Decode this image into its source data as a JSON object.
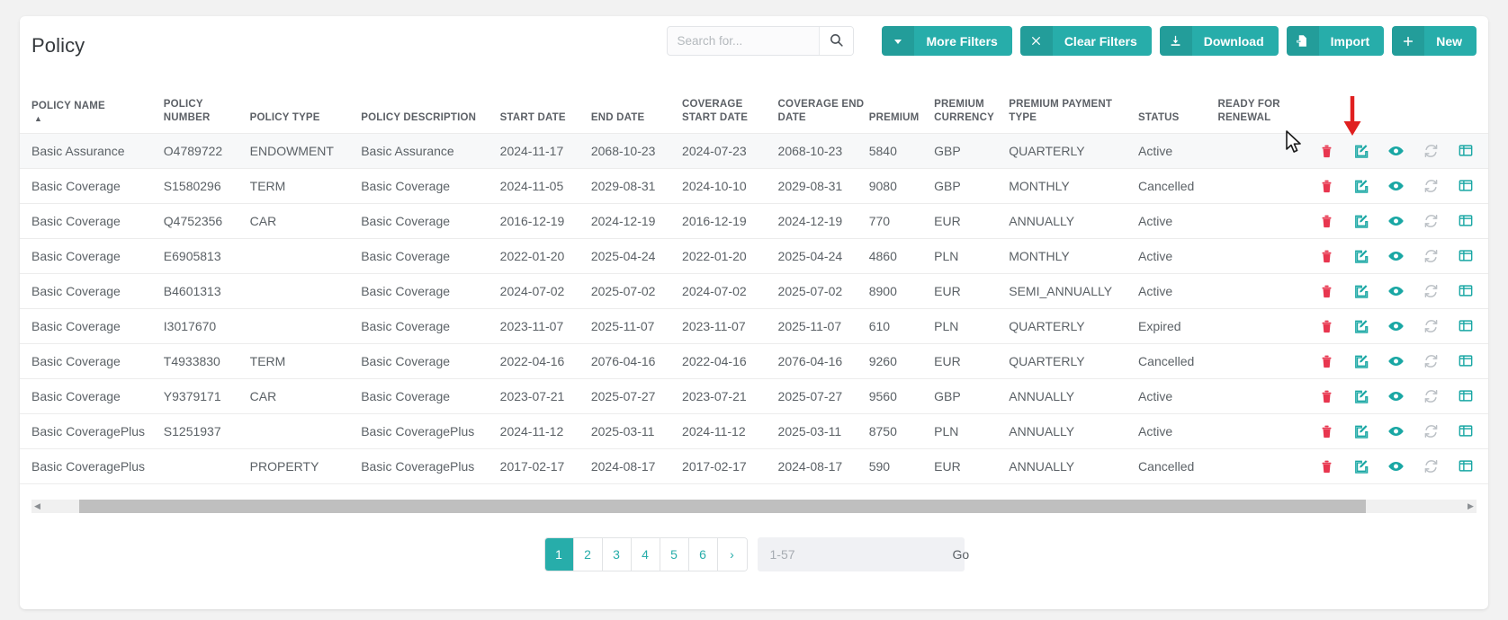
{
  "page": {
    "title": "Policy"
  },
  "search": {
    "placeholder": "Search for...",
    "value": "",
    "icon": "search-icon"
  },
  "toolbar": {
    "more_filters": {
      "label": "More Filters",
      "icon": "chevron-down-icon"
    },
    "clear_filters": {
      "label": "Clear Filters",
      "icon": "close-x-icon"
    },
    "download": {
      "label": "Download",
      "icon": "download-icon"
    },
    "import": {
      "label": "Import",
      "icon": "file-import-icon"
    },
    "new": {
      "label": "New",
      "icon": "plus-icon"
    }
  },
  "colors": {
    "accent": "#27adaa",
    "danger": "#e8364f",
    "arrow": "#e02020",
    "text": "#5b6166",
    "header_text": "#5c6066",
    "page_bg": "#f2f2f2"
  },
  "table": {
    "sort": {
      "column": "POLICY NAME",
      "direction": "asc",
      "caret": "▲"
    },
    "columns": [
      "POLICY NAME",
      "POLICY NUMBER",
      "POLICY TYPE",
      "POLICY DESCRIPTION",
      "START DATE",
      "END DATE",
      "COVERAGE START DATE",
      "COVERAGE END DATE",
      "PREMIUM",
      "PREMIUM CURRENCY",
      "PREMIUM PAYMENT TYPE",
      "STATUS",
      "READY FOR RENEWAL"
    ],
    "row_actions": [
      {
        "name": "delete-icon",
        "title": "Delete"
      },
      {
        "name": "edit-icon",
        "title": "Edit"
      },
      {
        "name": "eye-view-icon",
        "title": "View"
      },
      {
        "name": "refresh-icon",
        "title": "Refresh"
      },
      {
        "name": "columns-icon",
        "title": "Columns"
      },
      {
        "name": "save-icon",
        "title": "Save"
      }
    ],
    "rows": [
      {
        "policy_name": "Basic Assurance",
        "policy_number": "O4789722",
        "policy_type": "ENDOWMENT",
        "policy_description": "Basic Assurance",
        "start_date": "2024-11-17",
        "end_date": "2068-10-23",
        "coverage_start_date": "2024-07-23",
        "coverage_end_date": "2068-10-23",
        "premium": "5840",
        "premium_currency": "GBP",
        "premium_payment_type": "QUARTERLY",
        "status": "Active",
        "ready_for_renewal": ""
      },
      {
        "policy_name": "Basic Coverage",
        "policy_number": "S1580296",
        "policy_type": "TERM",
        "policy_description": "Basic Coverage",
        "start_date": "2024-11-05",
        "end_date": "2029-08-31",
        "coverage_start_date": "2024-10-10",
        "coverage_end_date": "2029-08-31",
        "premium": "9080",
        "premium_currency": "GBP",
        "premium_payment_type": "MONTHLY",
        "status": "Cancelled",
        "ready_for_renewal": ""
      },
      {
        "policy_name": "Basic Coverage",
        "policy_number": "Q4752356",
        "policy_type": "CAR",
        "policy_description": "Basic Coverage",
        "start_date": "2016-12-19",
        "end_date": "2024-12-19",
        "coverage_start_date": "2016-12-19",
        "coverage_end_date": "2024-12-19",
        "premium": "770",
        "premium_currency": "EUR",
        "premium_payment_type": "ANNUALLY",
        "status": "Active",
        "ready_for_renewal": ""
      },
      {
        "policy_name": "Basic Coverage",
        "policy_number": "E6905813",
        "policy_type": "",
        "policy_description": "Basic Coverage",
        "start_date": "2022-01-20",
        "end_date": "2025-04-24",
        "coverage_start_date": "2022-01-20",
        "coverage_end_date": "2025-04-24",
        "premium": "4860",
        "premium_currency": "PLN",
        "premium_payment_type": "MONTHLY",
        "status": "Active",
        "ready_for_renewal": ""
      },
      {
        "policy_name": "Basic Coverage",
        "policy_number": "B4601313",
        "policy_type": "",
        "policy_description": "Basic Coverage",
        "start_date": "2024-07-02",
        "end_date": "2025-07-02",
        "coverage_start_date": "2024-07-02",
        "coverage_end_date": "2025-07-02",
        "premium": "8900",
        "premium_currency": "EUR",
        "premium_payment_type": "SEMI_ANNUALLY",
        "status": "Active",
        "ready_for_renewal": ""
      },
      {
        "policy_name": "Basic Coverage",
        "policy_number": "I3017670",
        "policy_type": "",
        "policy_description": "Basic Coverage",
        "start_date": "2023-11-07",
        "end_date": "2025-11-07",
        "coverage_start_date": "2023-11-07",
        "coverage_end_date": "2025-11-07",
        "premium": "610",
        "premium_currency": "PLN",
        "premium_payment_type": "QUARTERLY",
        "status": "Expired",
        "ready_for_renewal": ""
      },
      {
        "policy_name": "Basic Coverage",
        "policy_number": "T4933830",
        "policy_type": "TERM",
        "policy_description": "Basic Coverage",
        "start_date": "2022-04-16",
        "end_date": "2076-04-16",
        "coverage_start_date": "2022-04-16",
        "coverage_end_date": "2076-04-16",
        "premium": "9260",
        "premium_currency": "EUR",
        "premium_payment_type": "QUARTERLY",
        "status": "Cancelled",
        "ready_for_renewal": ""
      },
      {
        "policy_name": "Basic Coverage",
        "policy_number": "Y9379171",
        "policy_type": "CAR",
        "policy_description": "Basic Coverage",
        "start_date": "2023-07-21",
        "end_date": "2025-07-27",
        "coverage_start_date": "2023-07-21",
        "coverage_end_date": "2025-07-27",
        "premium": "9560",
        "premium_currency": "GBP",
        "premium_payment_type": "ANNUALLY",
        "status": "Active",
        "ready_for_renewal": ""
      },
      {
        "policy_name": "Basic CoveragePlus",
        "policy_number": "S1251937",
        "policy_type": "",
        "policy_description": "Basic CoveragePlus",
        "start_date": "2024-11-12",
        "end_date": "2025-03-11",
        "coverage_start_date": "2024-11-12",
        "coverage_end_date": "2025-03-11",
        "premium": "8750",
        "premium_currency": "PLN",
        "premium_payment_type": "ANNUALLY",
        "status": "Active",
        "ready_for_renewal": ""
      },
      {
        "policy_name": "Basic CoveragePlus",
        "policy_number": "",
        "policy_type": "PROPERTY",
        "policy_description": "Basic CoveragePlus",
        "start_date": "2017-02-17",
        "end_date": "2024-08-17",
        "coverage_start_date": "2017-02-17",
        "coverage_end_date": "2024-08-17",
        "premium": "590",
        "premium_currency": "EUR",
        "premium_payment_type": "ANNUALLY",
        "status": "Cancelled",
        "ready_for_renewal": ""
      }
    ]
  },
  "pagination": {
    "pages": [
      "1",
      "2",
      "3",
      "4",
      "5",
      "6"
    ],
    "active": "1",
    "next_label": "›",
    "goto_placeholder": "1-57",
    "goto_value": "",
    "go_label": "Go"
  },
  "scrollbar": {
    "left_arrow": "◀",
    "right_arrow": "▶"
  }
}
